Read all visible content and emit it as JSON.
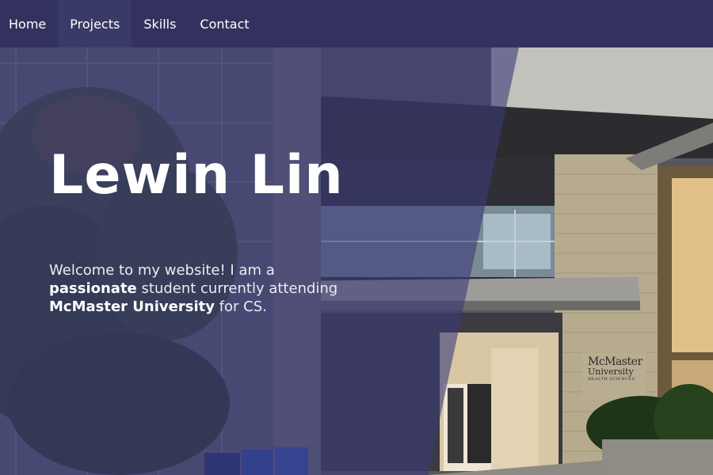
{
  "nav": {
    "items": [
      {
        "label": "Home",
        "active": false
      },
      {
        "label": "Projects",
        "active": true
      },
      {
        "label": "Skills",
        "active": false
      },
      {
        "label": "Contact",
        "active": false
      }
    ]
  },
  "hero": {
    "title": "Lewin Lin",
    "intro": {
      "part1": "Welcome to my website! I am a ",
      "emphasis1": "passionate",
      "part2": " student currently attending ",
      "emphasis2": "McMaster University",
      "part3": " for CS."
    },
    "sign": {
      "line1": "McMaster",
      "line2": "University",
      "line3": "HEALTH SCIENCES"
    }
  },
  "colors": {
    "navbar": "#33325e",
    "overlay": "#3b3a78",
    "text": "#ffffff"
  }
}
